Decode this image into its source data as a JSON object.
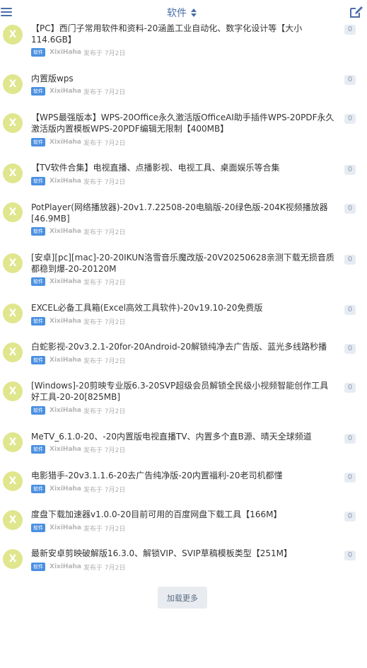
{
  "header": {
    "category": "软件",
    "menu_icon": "hamburger-menu-icon",
    "sort_icon": "sort-updown-icon",
    "compose_icon": "compose-edit-icon",
    "accent_color": "#4a6ea8"
  },
  "topics": [
    {
      "avatar": "X",
      "title": "【PC】西门子常用软件和资料-20涵盖工业自动化、数字化设计等【大小114.6GB】",
      "tag": "软件",
      "author": "XixiHaha",
      "published": "发布于 7月2日",
      "replies": "0"
    },
    {
      "avatar": "X",
      "title": "内置版wps",
      "tag": "软件",
      "author": "XixiHaha",
      "published": "发布于 7月2日",
      "replies": "0"
    },
    {
      "avatar": "X",
      "title": "【WPS最强版本】WPS-20Office永久激活版OfficeAI助手插件WPS-20PDF永久激活版内置模板WPS-20PDF编辑无限制【400MB】",
      "tag": "软件",
      "author": "XixiHaha",
      "published": "发布于 7月2日",
      "replies": "0"
    },
    {
      "avatar": "X",
      "title": "【TV软件合集】电视直播、点播影视、电视工具、桌面娱乐等合集",
      "tag": "软件",
      "author": "XixiHaha",
      "published": "发布于 7月2日",
      "replies": "0"
    },
    {
      "avatar": "X",
      "title": "PotPlayer(网络播放器)-20v1.7.22508-20电脑版-20绿色版-204K视频播放器[46.9MB]",
      "tag": "软件",
      "author": "XixiHaha",
      "published": "发布于 7月2日",
      "replies": "0"
    },
    {
      "avatar": "X",
      "title": "[安卓][pc][mac]-20-20IKUN洛雪音乐魔改版-20V20250628亲测下载无损音质都稳到爆-20-20120M",
      "tag": "软件",
      "author": "XixiHaha",
      "published": "发布于 7月2日",
      "replies": "0"
    },
    {
      "avatar": "X",
      "title": "EXCEL必备工具箱(Excel高效工具软件)-20v19.10-20免费版",
      "tag": "软件",
      "author": "XixiHaha",
      "published": "发布于 7月2日",
      "replies": "0"
    },
    {
      "avatar": "X",
      "title": "白蛇影视-20v3.2.1-20for-20Android-20解锁纯净去广告版、蓝光多线路秒播",
      "tag": "软件",
      "author": "XixiHaha",
      "published": "发布于 7月2日",
      "replies": "0"
    },
    {
      "avatar": "X",
      "title": "[Windows]-20剪映专业版6.3-20SVP超级会员解锁全民级小视频智能创作工具好工具-20-20[825MB]",
      "tag": "软件",
      "author": "XixiHaha",
      "published": "发布于 7月2日",
      "replies": "0"
    },
    {
      "avatar": "X",
      "title": "MeTV_6.1.0-20、-20内置版电视直播TV、内置多个直B源、晴天全球频道",
      "tag": "软件",
      "author": "XixiHaha",
      "published": "发布于 7月2日",
      "replies": "0"
    },
    {
      "avatar": "X",
      "title": "电影猎手-20v3.1.1.6-20去广告纯净版-20内置福利-20老司机都懂",
      "tag": "软件",
      "author": "XixiHaha",
      "published": "发布于 7月2日",
      "replies": "0"
    },
    {
      "avatar": "X",
      "title": "度盘下载加速器v1.0.0-20目前可用的百度网盘下载工具【166M】",
      "tag": "软件",
      "author": "XixiHaha",
      "published": "发布于 7月2日",
      "replies": "0"
    },
    {
      "avatar": "X",
      "title": "最新安卓剪映破解版16.3.0、解锁VIP、SVIP草稿模板类型【251M】",
      "tag": "软件",
      "author": "XixiHaha",
      "published": "发布于 7月2日",
      "replies": "0"
    }
  ],
  "load_more": "加载更多"
}
